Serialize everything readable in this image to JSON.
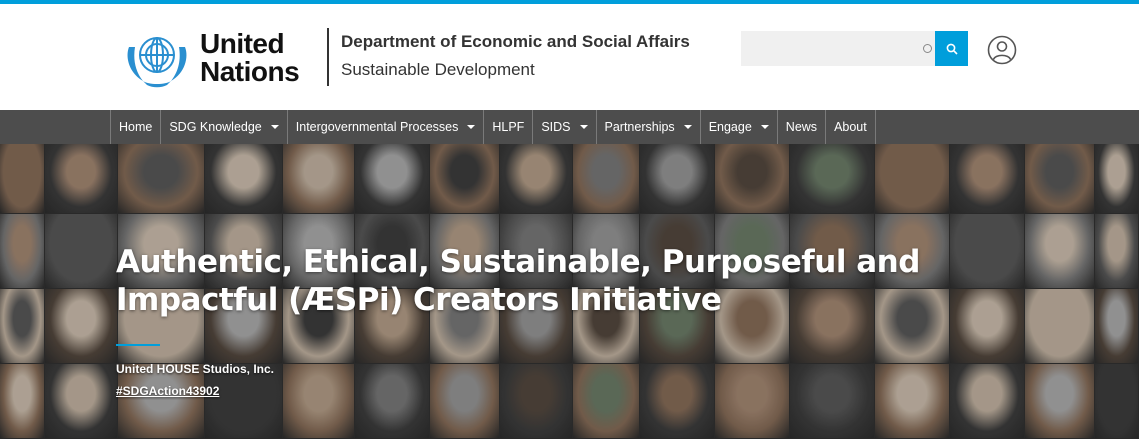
{
  "header": {
    "org_line1": "United",
    "org_line2": "Nations",
    "department": "Department of Economic and Social Affairs",
    "subtitle": "Sustainable Development",
    "search_placeholder": "",
    "accent_color": "#009edb"
  },
  "nav": {
    "items": [
      {
        "label": "Home",
        "has_dropdown": false
      },
      {
        "label": "SDG Knowledge",
        "has_dropdown": true
      },
      {
        "label": "Intergovernmental Processes",
        "has_dropdown": true
      },
      {
        "label": "HLPF",
        "has_dropdown": false
      },
      {
        "label": "SIDS",
        "has_dropdown": true
      },
      {
        "label": "Partnerships",
        "has_dropdown": true
      },
      {
        "label": "Engage",
        "has_dropdown": true
      },
      {
        "label": "News",
        "has_dropdown": false
      },
      {
        "label": "About",
        "has_dropdown": false
      }
    ]
  },
  "hero": {
    "title": "Authentic, Ethical, Sustainable, Purposeful and Impactful (ÆSPi) Creators Initiative",
    "organization": "United HOUSE Studios, Inc.",
    "tag": "#SDGAction43902"
  }
}
